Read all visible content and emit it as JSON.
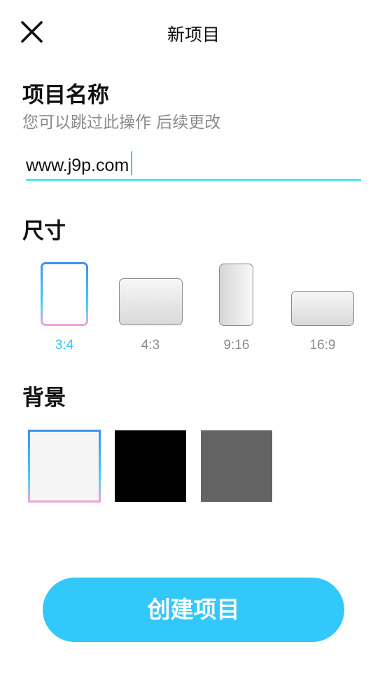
{
  "header": {
    "title": "新项目",
    "close_icon": "close-icon"
  },
  "project_name": {
    "heading": "项目名称",
    "subtitle": "您可以跳过此操作 后续更改",
    "input_value": "www.j9p.com",
    "underline_color": "#4ee6ef"
  },
  "size": {
    "heading": "尺寸",
    "selected": "3:4",
    "options": [
      {
        "label": "3:4"
      },
      {
        "label": "4:3"
      },
      {
        "label": "9:16"
      },
      {
        "label": "16:9"
      }
    ],
    "active_color": "#2fc6f3"
  },
  "background": {
    "heading": "背景",
    "selected_index": 0,
    "swatches": [
      {
        "color": "#f5f5f5"
      },
      {
        "color": "#000000"
      },
      {
        "color": "#646464"
      }
    ]
  },
  "create_button": {
    "label": "创建项目",
    "color": "#32c8fc"
  }
}
